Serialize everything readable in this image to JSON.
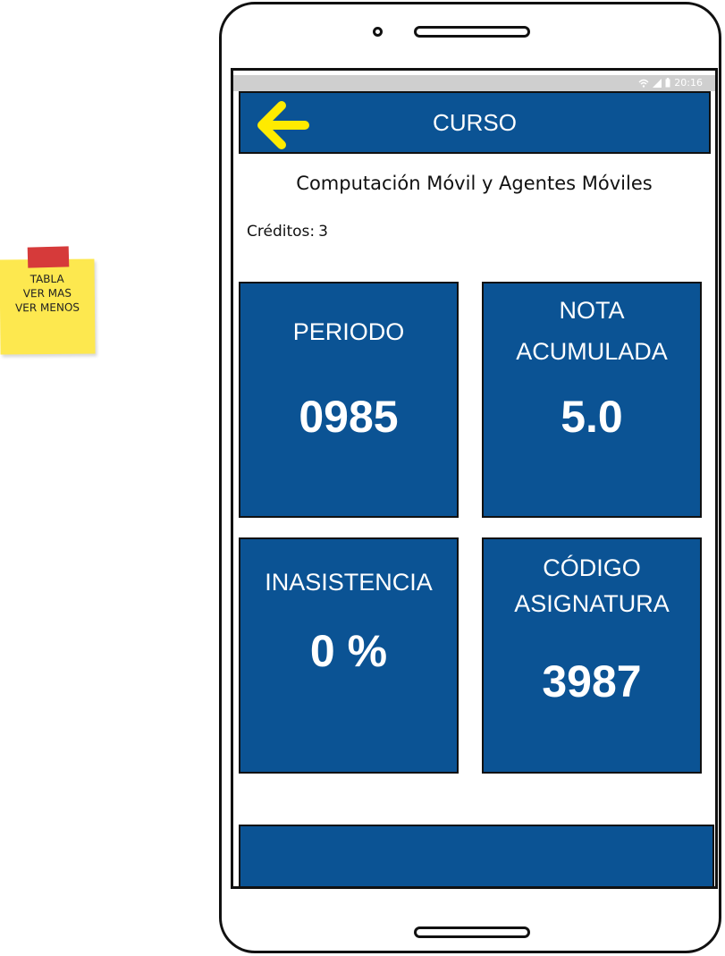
{
  "sticky_note": {
    "lines": [
      "TABLA",
      "VER MAS",
      "VER MENOS"
    ]
  },
  "status_bar": {
    "time": "20:16",
    "icons": [
      "wifi-icon",
      "signal-icon",
      "battery-icon"
    ]
  },
  "app_bar": {
    "title": "CURSO",
    "back_icon": "arrow-left-icon",
    "back_color": "#ffeb00"
  },
  "course": {
    "name": "Computación Móvil y Agentes Móviles",
    "credits_label": "Créditos:",
    "credits_value": "3"
  },
  "tiles": [
    {
      "label_lines": [
        "PERIODO"
      ],
      "value": "0985"
    },
    {
      "label_lines": [
        "NOTA",
        "ACUMULADA"
      ],
      "value": "5.0"
    },
    {
      "label_lines": [
        "INASISTENCIA"
      ],
      "value": "0 %"
    },
    {
      "label_lines": [
        "CÓDIGO",
        "ASIGNATURA"
      ],
      "value": "3987"
    }
  ],
  "colors": {
    "primary": "#0b5394",
    "sticky": "#fde84f",
    "tape": "#d63a3a"
  }
}
